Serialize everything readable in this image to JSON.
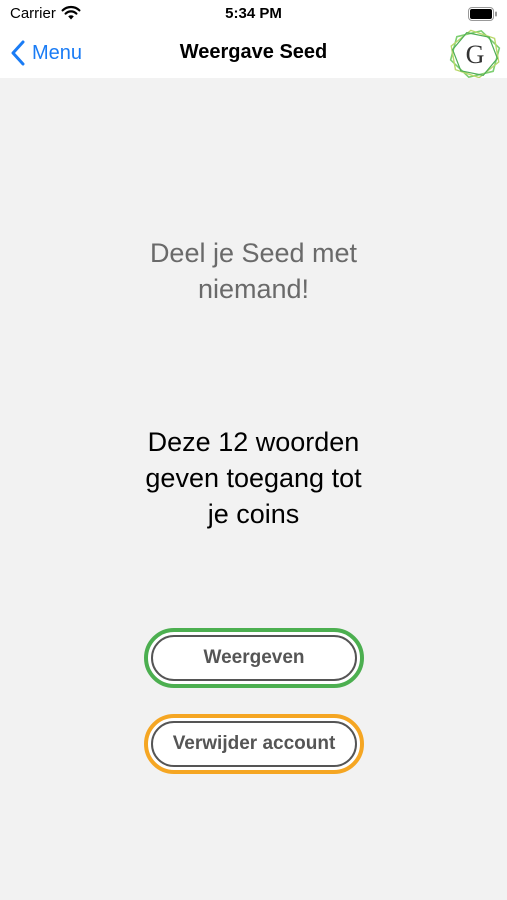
{
  "status_bar": {
    "carrier": "Carrier",
    "time": "5:34 PM"
  },
  "nav": {
    "back_label": "Menu",
    "title": "Weergave Seed",
    "logo_letter": "G"
  },
  "content": {
    "warning": "Deel je Seed met\nniemand!",
    "info": "Deze 12 woorden\ngeven toegang tot\nje coins"
  },
  "buttons": {
    "show_label": "Weergeven",
    "show_color": "#4caf50",
    "delete_label": "Verwijder account",
    "delete_color": "#f5a623"
  },
  "colors": {
    "accent": "#1a7cf5",
    "background": "#f2f2f2"
  }
}
